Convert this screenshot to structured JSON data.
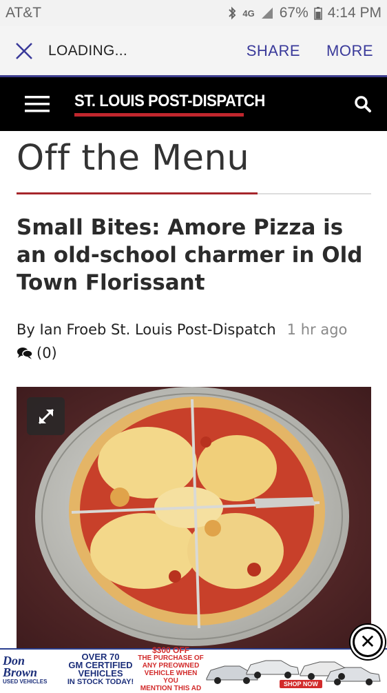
{
  "status_bar": {
    "carrier": "AT&T",
    "network": "4G",
    "battery": "67%",
    "time": "4:14 PM"
  },
  "browser_bar": {
    "loading": "LOADING...",
    "share": "SHARE",
    "more": "MORE"
  },
  "site": {
    "logo": "ST. LOUIS POST-DISPATCH",
    "brand_colors": {
      "header_bg": "#000000",
      "accent_red": "#c0262d",
      "link_blue": "#3a3a9a"
    }
  },
  "article": {
    "section": "Off the Menu",
    "headline": "Small Bites: Amore Pizza is an old-school charmer in Old Town Florissant",
    "byline": "By Ian Froeb St. Louis Post-Dispatch",
    "timestamp": "1 hr ago",
    "comment_count": "(0)"
  },
  "ad": {
    "brand_line1": "Don",
    "brand_line2": "Brown",
    "brand_sub": "USED VEHICLES",
    "headline1": "OVER 70",
    "headline2": "GM CERTIFIED",
    "headline3": "VEHICLES",
    "headline4": "IN STOCK TODAY!",
    "offer1": "$300 OFF",
    "offer2": "THE PURCHASE OF",
    "offer3": "ANY PREOWNED",
    "offer4": "VEHICLE WHEN YOU",
    "offer5": "MENTION THIS AD",
    "cta": "SHOP NOW"
  }
}
